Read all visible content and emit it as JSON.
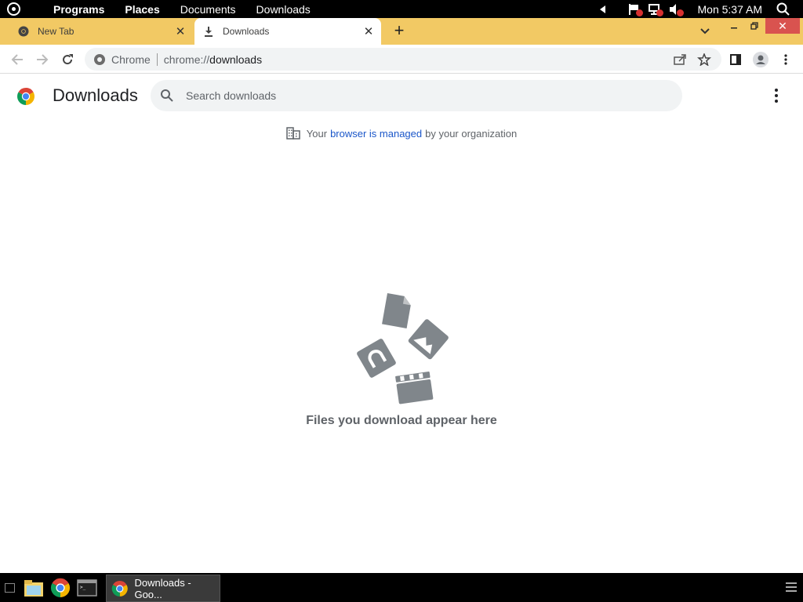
{
  "top_panel": {
    "menus": [
      "Programs",
      "Places",
      "Documents",
      "Downloads"
    ],
    "clock": "Mon 5:37 AM"
  },
  "tabs": [
    {
      "title": "New Tab",
      "icon": "chrome-icon",
      "active": false
    },
    {
      "title": "Downloads",
      "icon": "download-icon",
      "active": true
    }
  ],
  "window_controls": {
    "close": "✕"
  },
  "omnibox": {
    "site_label": "Chrome",
    "url_scheme": "chrome://",
    "url_host": "downloads"
  },
  "page": {
    "title": "Downloads",
    "search_placeholder": "Search downloads",
    "managed_prefix": "Your",
    "managed_link": "browser is managed",
    "managed_suffix": "by your organization",
    "empty_message": "Files you download appear here"
  },
  "taskbar": {
    "window_title": "Downloads - Goo..."
  },
  "colors": {
    "tabstrip": "#f2c964",
    "close_button": "#d9534f",
    "link": "#1a56c9",
    "illustration": "#80868b"
  }
}
